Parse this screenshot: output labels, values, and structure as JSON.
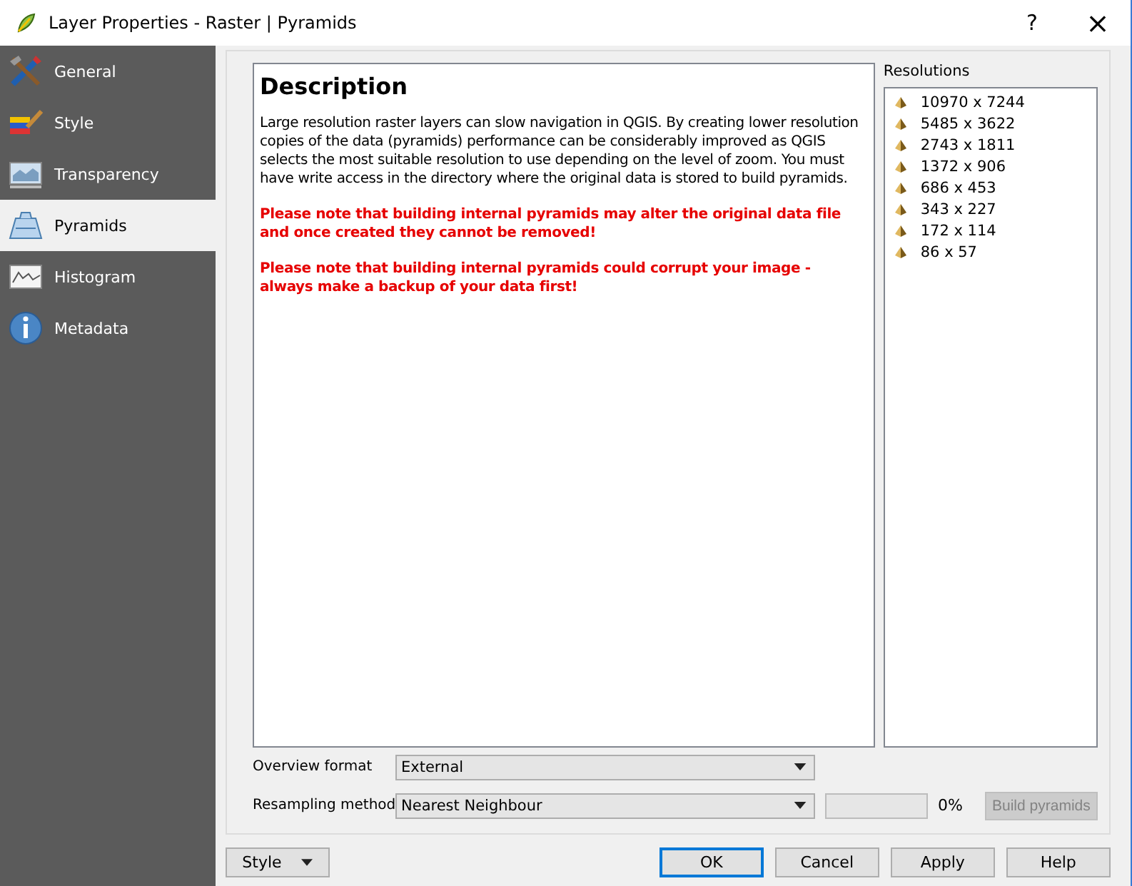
{
  "window": {
    "title": "Layer Properties - Raster | Pyramids",
    "help": "?",
    "close": "×"
  },
  "sidebar": {
    "items": [
      {
        "label": "General",
        "kind": "general",
        "selected": false
      },
      {
        "label": "Style",
        "kind": "style",
        "selected": false
      },
      {
        "label": "Transparency",
        "kind": "transparency",
        "selected": false
      },
      {
        "label": "Pyramids",
        "kind": "pyramids",
        "selected": true
      },
      {
        "label": "Histogram",
        "kind": "histogram",
        "selected": false
      },
      {
        "label": "Metadata",
        "kind": "metadata",
        "selected": false
      }
    ]
  },
  "description": {
    "heading": "Description",
    "paragraphs": [
      {
        "text": "Large resolution raster layers can slow navigation in QGIS. By creating lower resolution copies of the data (pyramids) performance can be considerably improved as QGIS selects the most suitable resolution to use depending on the level of zoom. You must have write access in the directory where the original data is stored to build pyramids.",
        "warning": false
      },
      {
        "text": "Please note that building internal pyramids may alter the original data file and once created they cannot be removed!",
        "warning": true
      },
      {
        "text": "Please note that building internal pyramids could corrupt your image - always make a backup of your data first!",
        "warning": true
      }
    ]
  },
  "resolutions": {
    "label": "Resolutions",
    "items": [
      "10970 x 7244",
      "5485 x 3622",
      "2743 x 1811",
      "1372 x 906",
      "686 x 453",
      "343 x 227",
      "172 x 114",
      "86 x 57"
    ]
  },
  "overview_format": {
    "label": "Overview format",
    "value": "External"
  },
  "resampling_method": {
    "label": "Resampling method",
    "value": "Nearest Neighbour"
  },
  "progress": {
    "level": 0,
    "reading": "0%"
  },
  "build_button": {
    "label": "Build pyramids",
    "disabled": true
  },
  "footer": {
    "style_button": "Style",
    "buttons": [
      {
        "label": "OK",
        "default": true
      },
      {
        "label": "Cancel",
        "default": false
      },
      {
        "label": "Apply",
        "default": false
      },
      {
        "label": "Help",
        "default": false
      }
    ]
  }
}
